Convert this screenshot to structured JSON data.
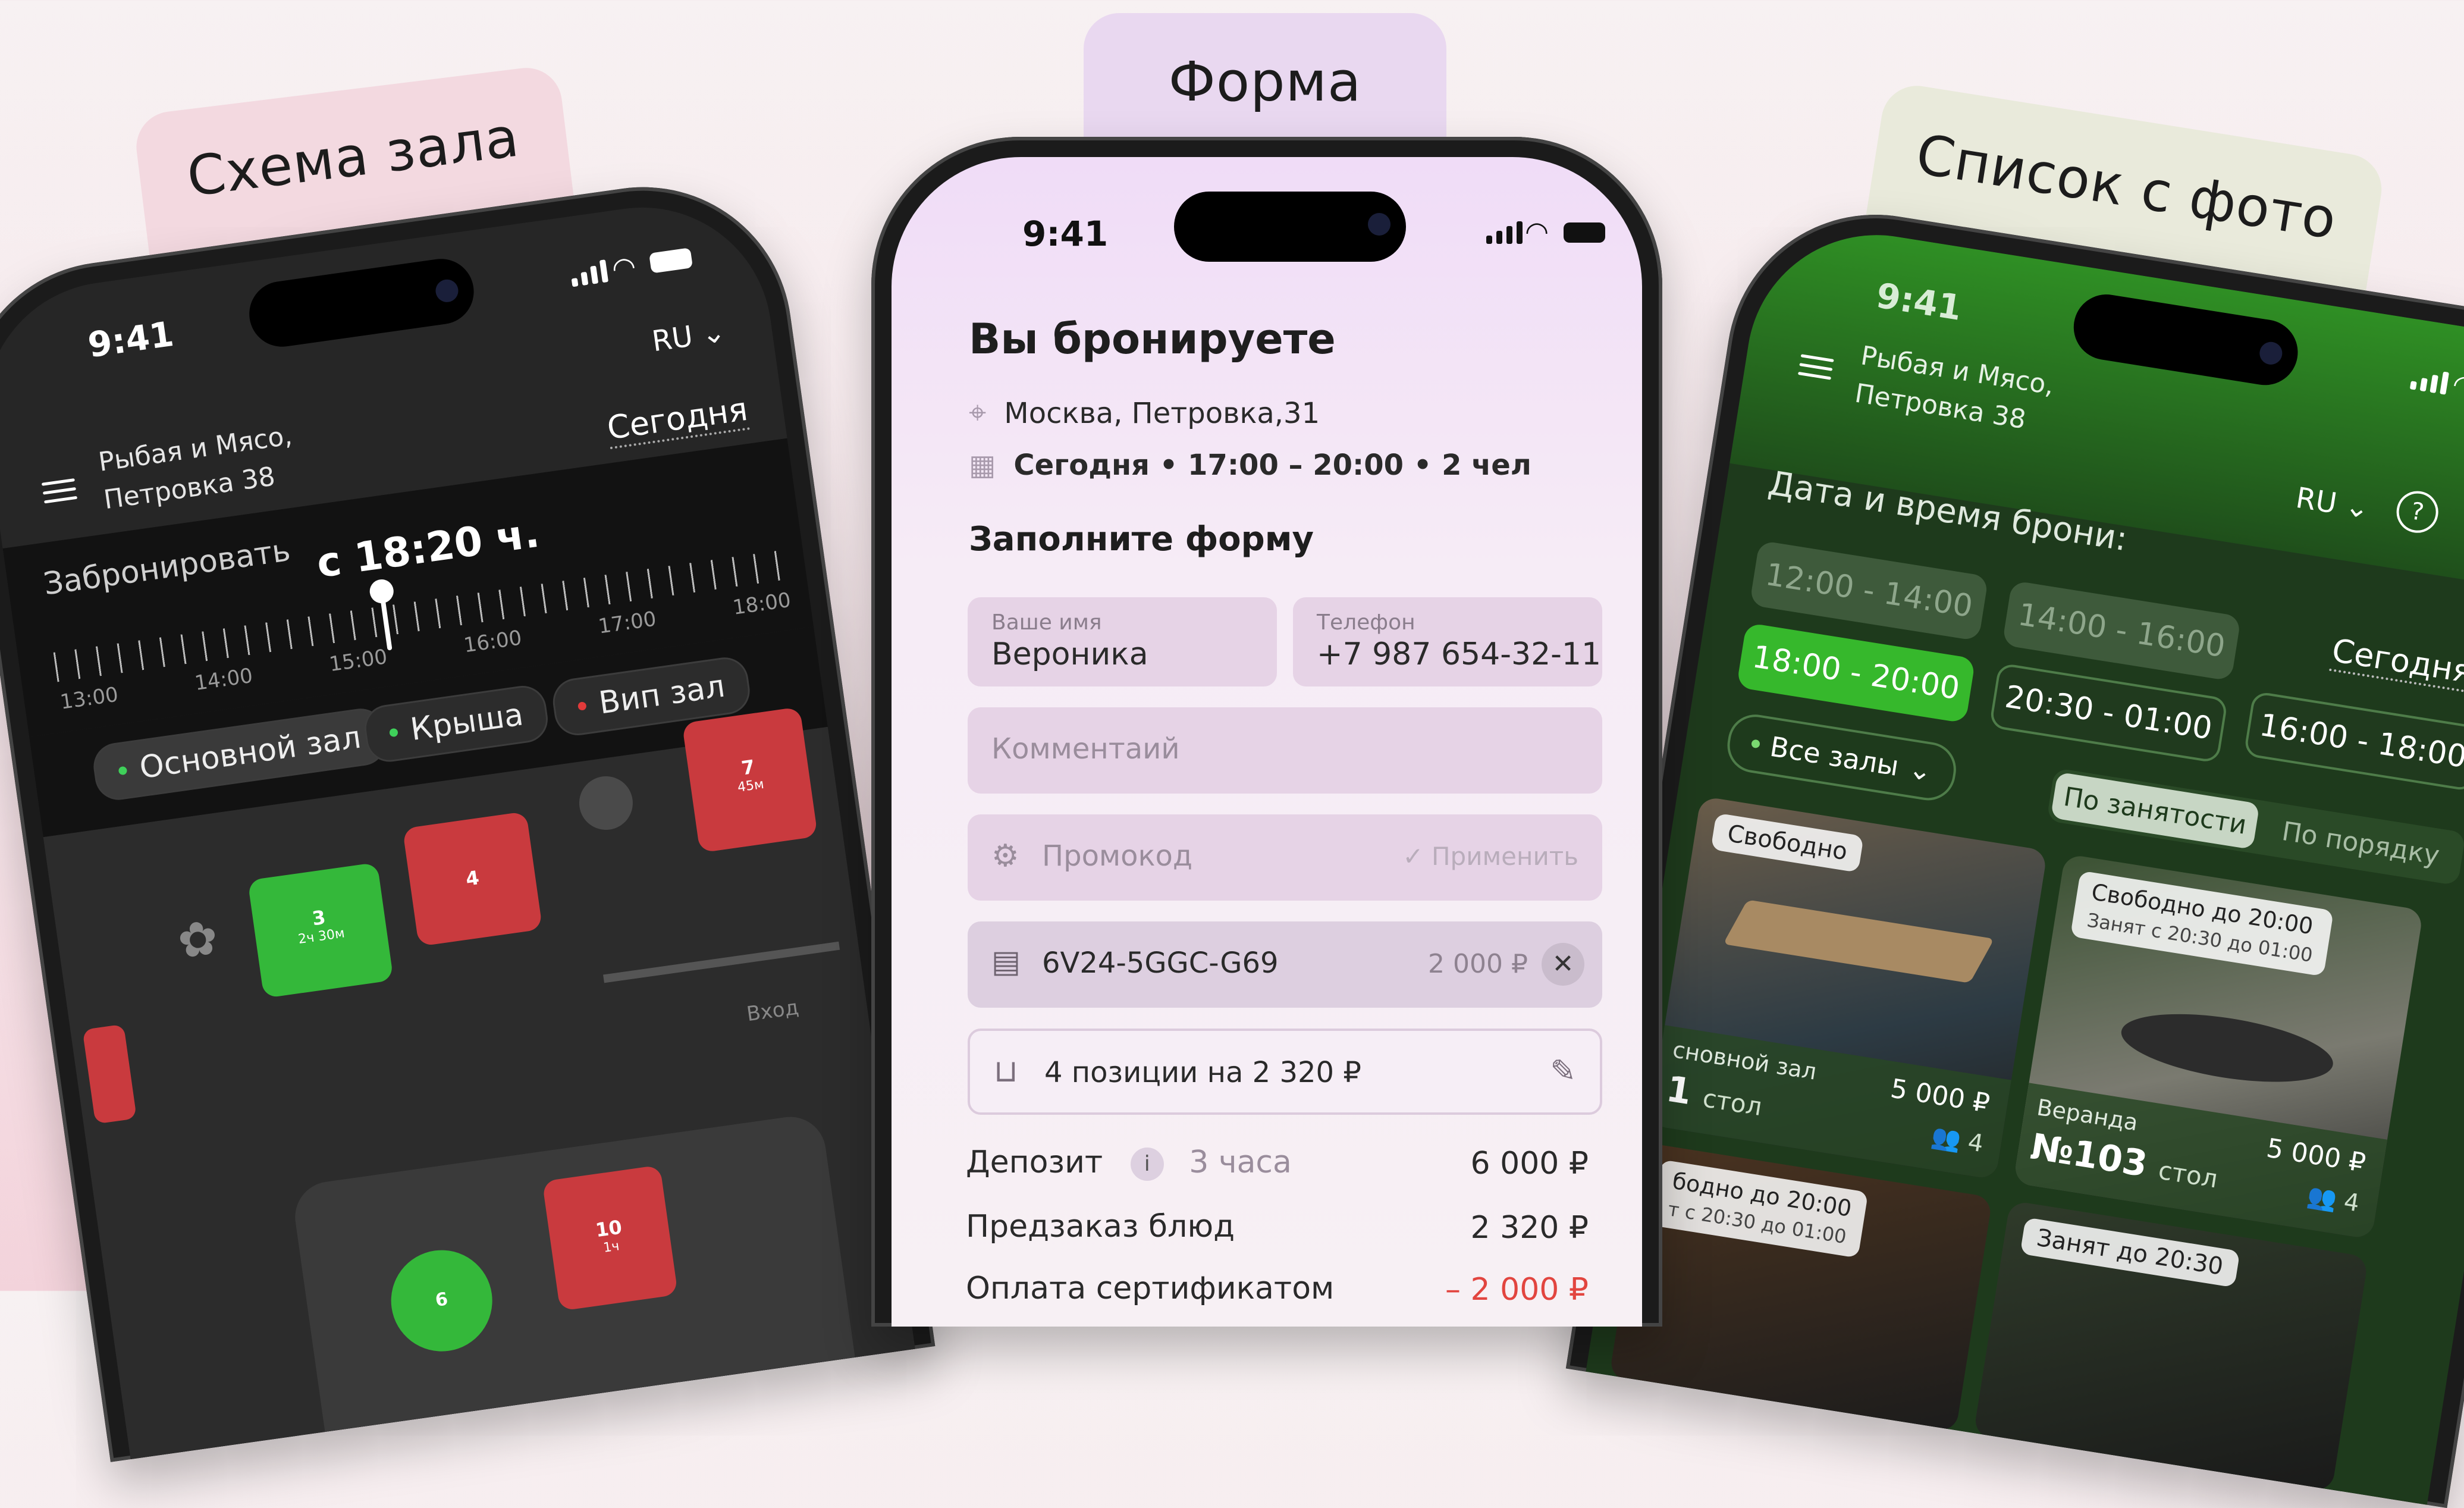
{
  "labels": {
    "left": "Схема зала",
    "middle": "Форма",
    "right": "Список с фото"
  },
  "left_phone": {
    "time": "9:41",
    "lang": "RU",
    "venue_line1": "Рыбая и Мясо,",
    "venue_line2": "Петровка 38",
    "today": "Сегодня",
    "book_label": "Забронировать",
    "selected_time": "с 18:20 ч.",
    "ticks": [
      "13:00",
      "14:00",
      "15:00",
      "16:00",
      "17:00",
      "18:00"
    ],
    "halls": [
      {
        "name": "Основной зал",
        "dot": "#3fd05a"
      },
      {
        "name": "Крыша",
        "dot": "#3fd05a"
      },
      {
        "name": "Вип зал",
        "dot": "#e23a3a"
      }
    ],
    "tables": [
      {
        "num": "3",
        "sub": "2ч 30м",
        "color": "#34b83a"
      },
      {
        "num": "4",
        "sub": "",
        "color": "#c93a3e"
      },
      {
        "num": "7",
        "sub": "45м",
        "color": "#c93a3e"
      },
      {
        "num": "6",
        "sub": "",
        "color": "#34b83a"
      },
      {
        "num": "10",
        "sub": "1ч",
        "color": "#c93a3e"
      }
    ],
    "entrance": "Вход"
  },
  "middle_phone": {
    "time": "9:41",
    "title": "Вы бронируете",
    "address": "Москва, Петровка,31",
    "datetime": "Сегодня • 17:00 – 20:00 • 2 чел",
    "form_title": "Заполните форму",
    "name_label": "Ваше имя",
    "name_value": "Вероника",
    "phone_label": "Телефон",
    "phone_value": "+7 987 654-32-11",
    "comment_placeholder": "Комментаий",
    "promo_placeholder": "Промокод",
    "apply_label": "Применить",
    "certificate_code": "6V24-5GGC-G69",
    "certificate_amount": "2 000 ₽",
    "cart_text": "4 позиции на 2 320 ₽",
    "summary": [
      {
        "label": "Депозит",
        "note": "3 часа",
        "amount": "6 000 ₽",
        "color": "#2a2a2a"
      },
      {
        "label": "Предзаказ блюд",
        "note": "",
        "amount": "2 320 ₽",
        "color": "#2a2a2a"
      },
      {
        "label": "Оплата сертификатом",
        "note": "",
        "amount": "– 2 000 ₽",
        "color": "#e2453f"
      }
    ]
  },
  "right_phone": {
    "time": "9:41",
    "venue_line1": "Рыбая и Мясо,",
    "venue_line2": "Петровка 38",
    "lang": "RU",
    "heading": "Дата и время брони:",
    "today": "Сегодня",
    "slots": [
      {
        "label": "12:00 - 14:00",
        "state": "disabled"
      },
      {
        "label": "14:00 - 16:00",
        "state": "disabled"
      },
      {
        "label": "16:00 - 18:00",
        "state": "normal"
      },
      {
        "label": "18:00 - 20:00",
        "state": "selected"
      },
      {
        "label": "20:30 - 01:00",
        "state": "normal"
      }
    ],
    "halls_filter": "Все залы",
    "sort_busy": "По занятости",
    "sort_order": "По порядку",
    "cards": [
      {
        "status": "Свободно",
        "status2": "",
        "hall": "сновной зал",
        "num": "1",
        "unit": "стол",
        "price": "5 000 ₽",
        "seats": "4"
      },
      {
        "status": "Свободно до 20:00",
        "status2": "Занят с 20:30 до 01:00",
        "hall": "Веранда",
        "num": "№103",
        "unit": "стол",
        "price": "5 000 ₽",
        "seats": "4"
      },
      {
        "status": "бодно до 20:00",
        "status2": "т с 20:30 до 01:00",
        "hall": "",
        "num": "",
        "unit": "",
        "price": "",
        "seats": ""
      },
      {
        "status": "Занят до 20:30",
        "status2": "",
        "hall": "",
        "num": "",
        "unit": "",
        "price": "",
        "seats": ""
      }
    ]
  }
}
